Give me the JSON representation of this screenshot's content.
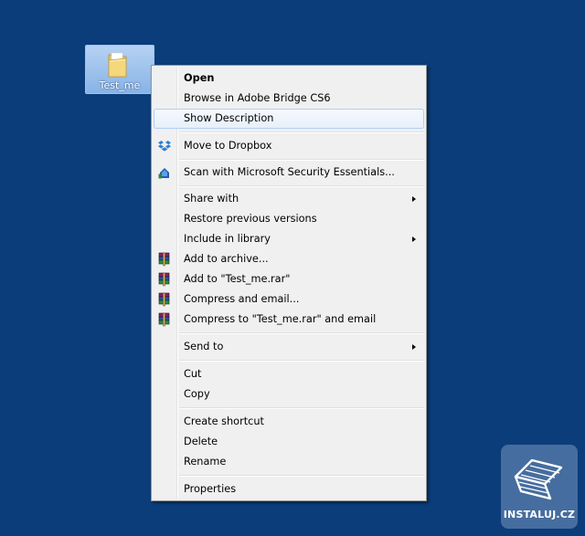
{
  "desktop": {
    "background_color": "#0b3d7a",
    "folder": {
      "label": "Test_me",
      "icon": "folder-icon"
    }
  },
  "context_menu": {
    "items": [
      {
        "label": "Open",
        "bold": true
      },
      {
        "label": "Browse in Adobe Bridge CS6"
      },
      {
        "label": "Show Description",
        "highlighted": true
      },
      {
        "label": "Move to Dropbox",
        "icon": "dropbox-icon"
      },
      {
        "label": "Scan with Microsoft Security Essentials...",
        "icon": "security-essentials-icon"
      },
      {
        "label": "Share with",
        "submenu": true
      },
      {
        "label": "Restore previous versions"
      },
      {
        "label": "Include in library",
        "submenu": true
      },
      {
        "label": "Add to archive...",
        "icon": "winrar-icon"
      },
      {
        "label": "Add to \"Test_me.rar\"",
        "icon": "winrar-icon"
      },
      {
        "label": "Compress and email...",
        "icon": "winrar-icon"
      },
      {
        "label": "Compress to \"Test_me.rar\" and email",
        "icon": "winrar-icon"
      },
      {
        "label": "Send to",
        "submenu": true
      },
      {
        "label": "Cut"
      },
      {
        "label": "Copy"
      },
      {
        "label": "Create shortcut"
      },
      {
        "label": "Delete"
      },
      {
        "label": "Rename"
      },
      {
        "label": "Properties"
      }
    ]
  },
  "watermark": {
    "text": "INSTALUJ.CZ",
    "icon": "instaluj-logo-icon"
  }
}
